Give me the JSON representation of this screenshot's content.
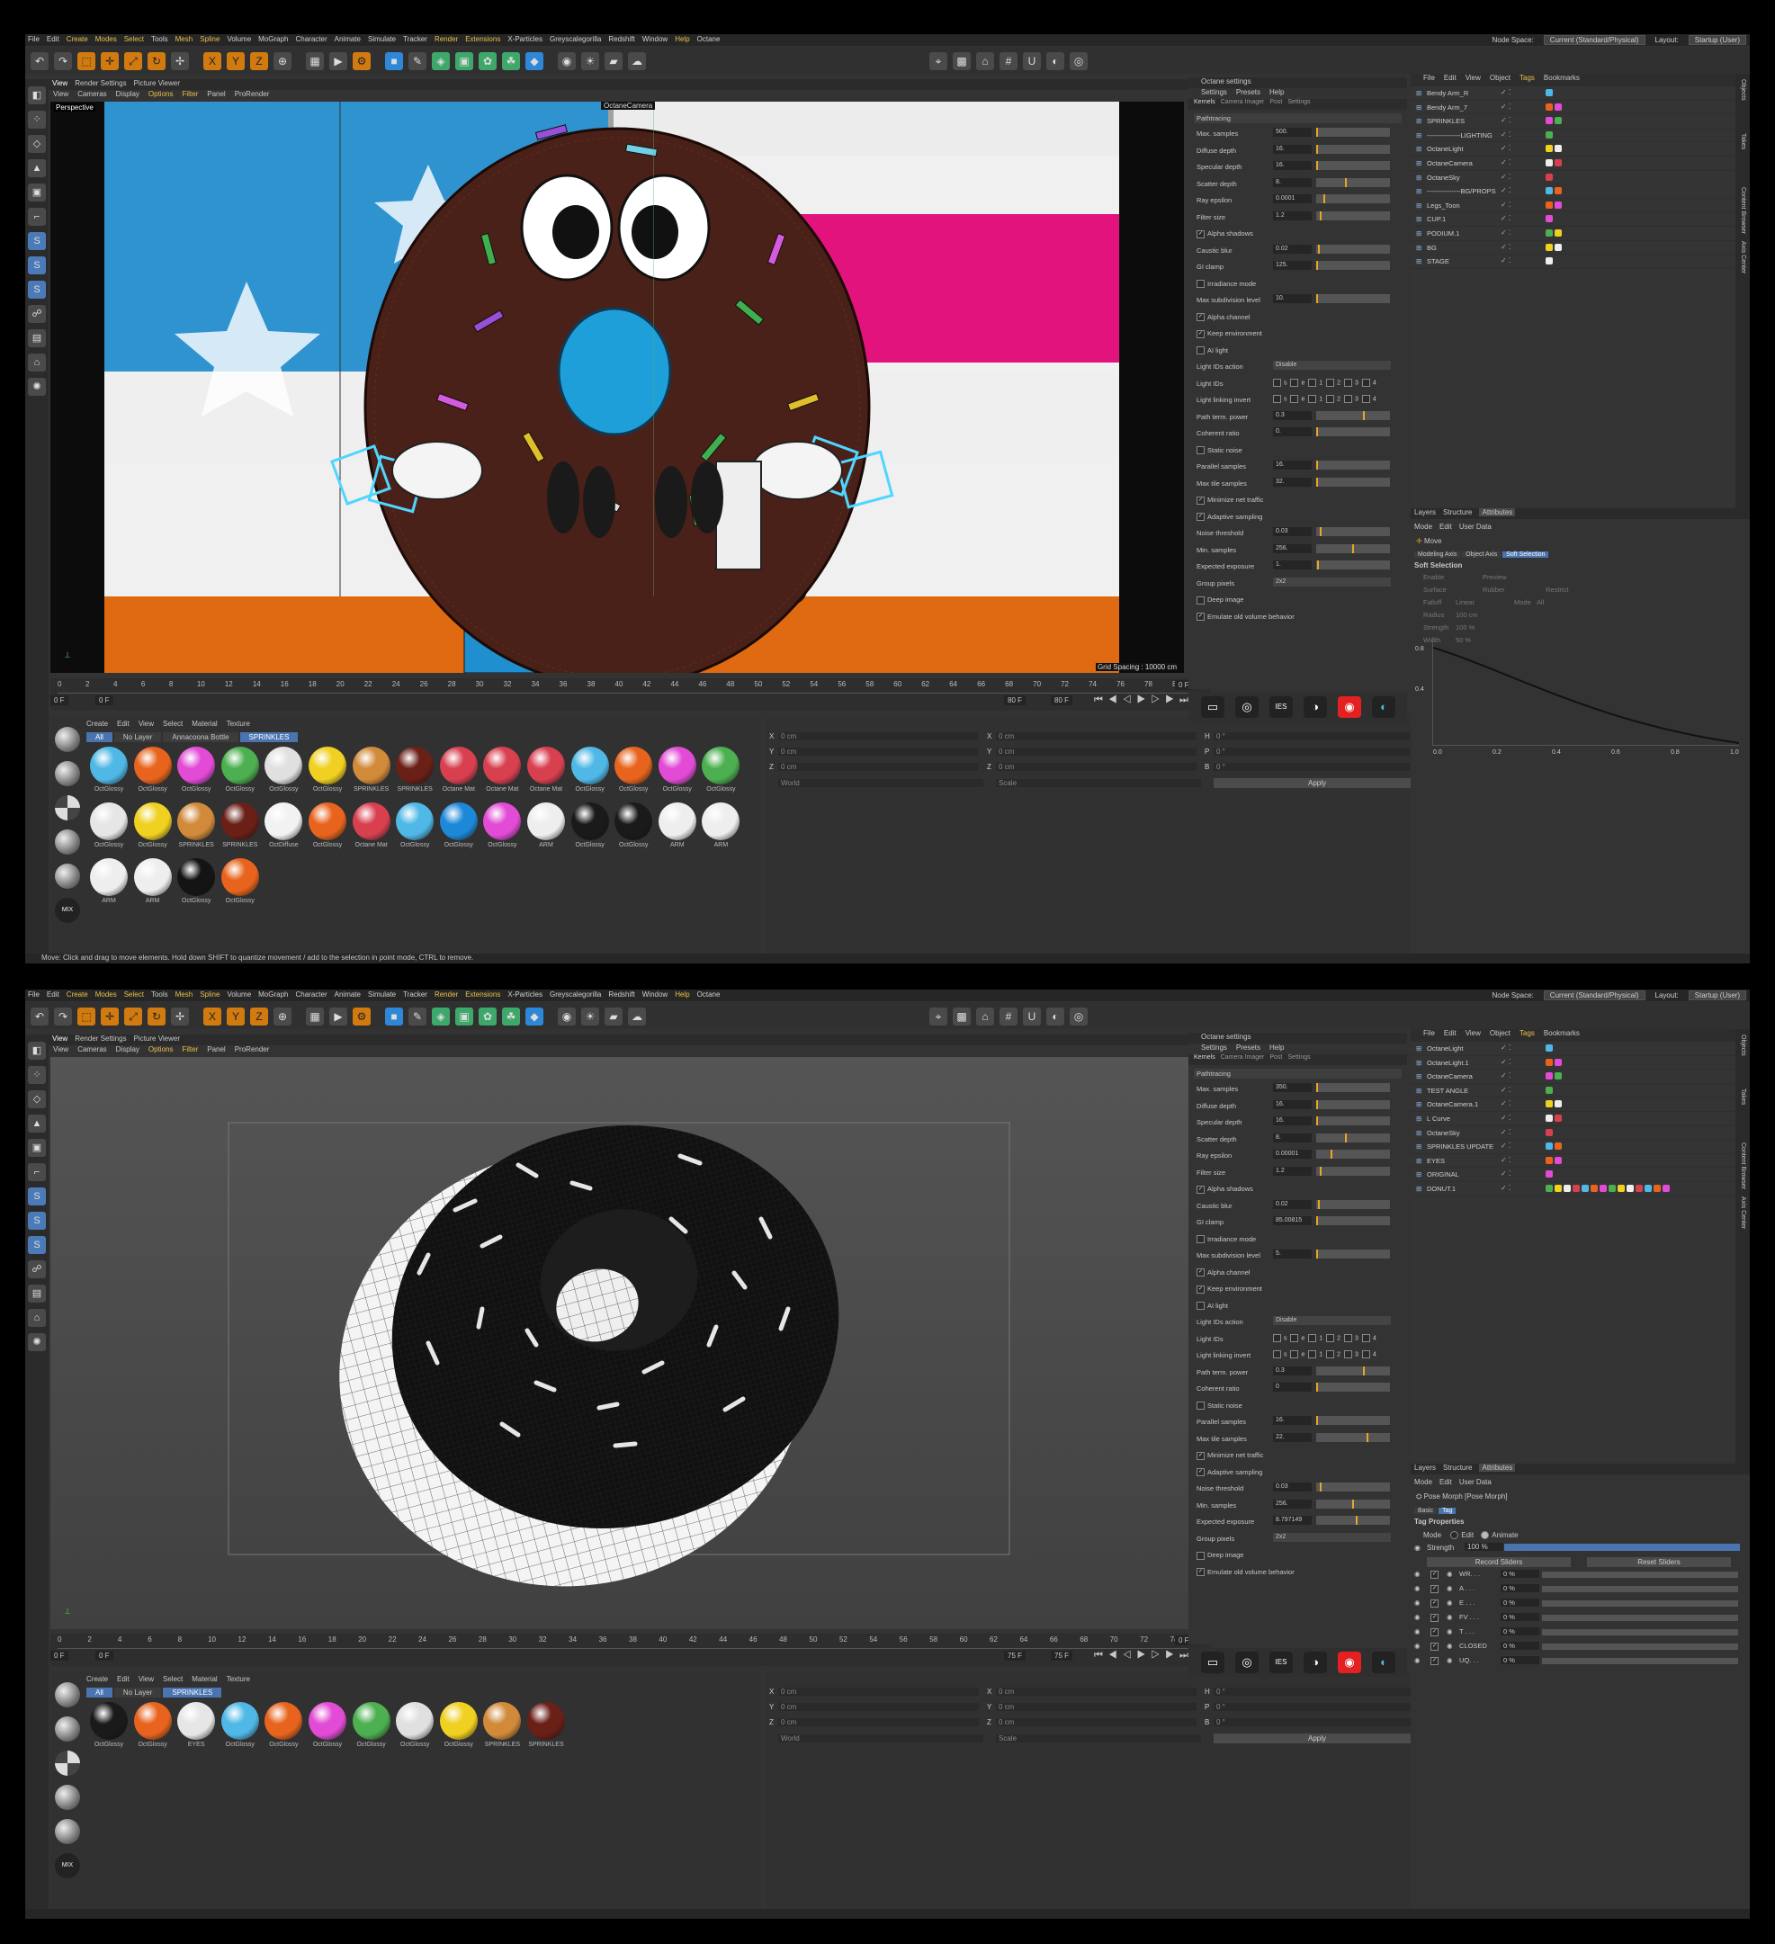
{
  "menu": [
    "File",
    "Edit",
    "Create",
    "Modes",
    "Select",
    "Tools",
    "Mesh",
    "Spline",
    "Volume",
    "MoGraph",
    "Character",
    "Animate",
    "Simulate",
    "Tracker",
    "Render",
    "Extensions",
    "X-Particles",
    "Greyscalegorilla",
    "Redshift",
    "Window",
    "Help",
    "Octane"
  ],
  "node_space_label": "Node Space:",
  "node_space_value": "Current (Standard/Physical)",
  "layout_label": "Layout:",
  "layout_value": "Startup (User)",
  "viewport_tabs": [
    "View",
    "Render Settings",
    "Picture Viewer"
  ],
  "viewport_menu": [
    "View",
    "Cameras",
    "Display",
    "Options",
    "Filter",
    "Panel",
    "ProRender"
  ],
  "octane_title": "Octane settings",
  "octane_menu": [
    "Settings",
    "Presets",
    "Help"
  ],
  "octane_tabs": [
    "Kernels",
    "Camera Imager",
    "Post",
    "Settings"
  ],
  "octane_section": "Pathtracing",
  "obj_menu": [
    "File",
    "Edit",
    "View",
    "Object",
    "Tags",
    "Bookmarks"
  ],
  "attr_tabs": [
    "Layers",
    "Structure",
    "Attributes"
  ],
  "attr_menu": [
    "Mode",
    "Edit",
    "User Data"
  ],
  "coord": {
    "x": "X",
    "y": "Y",
    "z": "Z",
    "h": "H",
    "p": "P",
    "b": "B",
    "zero_cm": "0 cm",
    "zero_deg": "0 °",
    "world": "World",
    "scale": "Scale",
    "apply": "Apply"
  },
  "mat_menu": [
    "Create",
    "Edit",
    "View",
    "Select",
    "Material",
    "Texture"
  ],
  "side_tabs": [
    "Objects",
    "Takes",
    "Content Browser",
    "Axis Center"
  ],
  "top": {
    "perspective": "Perspective",
    "camera_label": "OctaneCamera",
    "grid_spacing": "Grid Spacing : 10000 cm",
    "ruler": [
      "0",
      "2",
      "4",
      "6",
      "8",
      "10",
      "12",
      "14",
      "16",
      "18",
      "20",
      "22",
      "24",
      "26",
      "28",
      "30",
      "32",
      "34",
      "36",
      "38",
      "40",
      "42",
      "44",
      "46",
      "48",
      "50",
      "52",
      "54",
      "56",
      "58",
      "60",
      "62",
      "64",
      "66",
      "68",
      "70",
      "72",
      "74",
      "76",
      "78",
      "80"
    ],
    "frame_start": "0 F",
    "frame_start2": "0 F",
    "frame_end": "80 F",
    "frame_end2": "80 F",
    "frame_cur": "0 F",
    "mat_tabs": [
      "All",
      "No Layer",
      "Annacoona Bottle",
      "SPRINKLES"
    ],
    "materials": [
      {
        "label": "OctGlossy",
        "color": "#4fb8e6"
      },
      {
        "label": "OctGlossy",
        "color": "#e8641e"
      },
      {
        "label": "OctGlossy",
        "color": "#e24bd6"
      },
      {
        "label": "OctGlossy",
        "color": "#4caf50"
      },
      {
        "label": "OctGlossy",
        "color": "#e0e0e0"
      },
      {
        "label": "OctGlossy",
        "color": "#f0d020"
      },
      {
        "label": "SPRINKLES",
        "color": "#d08a3a"
      },
      {
        "label": "SPRINKLES",
        "color": "#6a1f17"
      },
      {
        "label": "Octane Mat",
        "color": "#d84050"
      },
      {
        "label": "Octane Mat",
        "color": "#d84050"
      },
      {
        "label": "Octane Mat",
        "color": "#d84050"
      },
      {
        "label": "OctGlossy",
        "color": "#4fb8e6"
      },
      {
        "label": "OctGlossy",
        "color": "#e8641e"
      },
      {
        "label": "OctGlossy",
        "color": "#e24bd6"
      },
      {
        "label": "OctGlossy",
        "color": "#4caf50"
      },
      {
        "label": "OctGlossy",
        "color": "#e6e6e6"
      },
      {
        "label": "OctGlossy",
        "color": "#f0d020"
      },
      {
        "label": "SPRINKLES",
        "color": "#d08a3a"
      },
      {
        "label": "SPRINKLES",
        "color": "#6a1f17"
      },
      {
        "label": "OctDiffuse",
        "color": "#f2f2f2"
      },
      {
        "label": "OctGlossy",
        "color": "#e8641e"
      },
      {
        "label": "Octane Mat",
        "color": "#d84050"
      },
      {
        "label": "OctGlossy",
        "color": "#4fb8e6"
      },
      {
        "label": "OctGlossy",
        "color": "#1e88d8"
      },
      {
        "label": "OctGlossy",
        "color": "#e24bd6"
      },
      {
        "label": "ARM",
        "color": "#eeeeee"
      },
      {
        "label": "OctGlossy",
        "color": "#1a1a1a"
      },
      {
        "label": "OctGlossy",
        "color": "#1a1a1a"
      },
      {
        "label": "ARM",
        "color": "#eeeeee"
      },
      {
        "label": "ARM",
        "color": "#eeeeee"
      },
      {
        "label": "ARM",
        "color": "#eeeeee"
      },
      {
        "label": "ARM",
        "color": "#eeeeee"
      },
      {
        "label": "OctGlossy",
        "color": "#141414"
      },
      {
        "label": "OctGlossy",
        "color": "#e8641e"
      }
    ],
    "settings": [
      {
        "label": "Max. samples",
        "value": "500.",
        "fill": 0.0
      },
      {
        "label": "Diffuse depth",
        "value": "16.",
        "fill": 0.0
      },
      {
        "label": "Specular depth",
        "value": "16.",
        "fill": 0.0
      },
      {
        "label": "Scatter depth",
        "value": "8.",
        "fill": 0.4
      },
      {
        "label": "Ray epsilon",
        "value": "0.0001",
        "fill": 0.1
      },
      {
        "label": "Filter size",
        "value": "1.2",
        "fill": 0.05
      },
      {
        "label": "Alpha shadows",
        "check": true
      },
      {
        "label": "Caustic blur",
        "value": "0.02",
        "fill": 0.02
      },
      {
        "label": "GI clamp",
        "value": "125.",
        "fill": 0.0
      },
      {
        "label": "Irradiance mode",
        "check": false
      },
      {
        "label": "Max subdivision level",
        "value": "10.",
        "fill": 0.0
      },
      {
        "label": "Alpha channel",
        "check": true
      },
      {
        "label": "Keep environment",
        "check": true
      },
      {
        "label": "AI light",
        "check": false
      },
      {
        "label": "Light IDs action",
        "value": "Disable",
        "select": true
      },
      {
        "label": "Light IDs",
        "ids": true
      },
      {
        "label": "Light linking invert",
        "ids": true
      },
      {
        "label": "Path term. power",
        "value": "0.3",
        "fill": 0.65
      },
      {
        "label": "Coherent ratio",
        "value": "0.",
        "fill": 0.0
      },
      {
        "label": "Static noise",
        "check": false
      },
      {
        "label": "Parallel samples",
        "value": "16.",
        "fill": 0.0
      },
      {
        "label": "Max tile samples",
        "value": "32.",
        "fill": 0.0
      },
      {
        "label": "Minimize net traffic",
        "check": true
      },
      {
        "label": "Adaptive sampling",
        "check": true
      },
      {
        "label": "Noise threshold",
        "value": "0.03",
        "fill": 0.05
      },
      {
        "label": "Min. samples",
        "value": "256.",
        "fill": 0.5
      },
      {
        "label": "Expected exposure",
        "value": "1.",
        "fill": 0.01
      },
      {
        "label": "Group pixels",
        "value": "2x2",
        "select": true
      },
      {
        "label": "Deep image",
        "check": false
      },
      {
        "label": "Emulate old volume behavior",
        "check": true
      }
    ],
    "objects": [
      {
        "name": "Bendy Arm_R",
        "blue": false
      },
      {
        "name": "Bendy Arm_7",
        "blue": false
      },
      {
        "name": "SPRINKLES",
        "blue": false
      },
      {
        "name": "---------------LIGHTING",
        "blue": false
      },
      {
        "name": "OctaneLight",
        "blue": false
      },
      {
        "name": "OctaneCamera",
        "blue": false
      },
      {
        "name": "OctaneSky",
        "blue": false
      },
      {
        "name": "---------------BG/PROPS",
        "blue": false
      },
      {
        "name": "Legs_Toon",
        "blue": false
      },
      {
        "name": "CUP.1",
        "blue": false
      },
      {
        "name": "PODIUM.1",
        "blue": false
      },
      {
        "name": "BG",
        "blue": false
      },
      {
        "name": "STAGE",
        "blue": false
      }
    ],
    "attr_mode": "Move",
    "attr_sub_tabs": [
      "Modeling Axis",
      "Object Axis",
      "Soft Selection"
    ],
    "soft_title": "Soft Selection",
    "soft_rows": [
      "Enable",
      "Preview",
      "Surface",
      "Rubber",
      "Restrict",
      "Falloff",
      "Linear",
      "Mode",
      "All",
      "Radius",
      "100 cm",
      "Strength",
      "100 %",
      "Width",
      "50 %"
    ],
    "graph_x": [
      "0.0",
      "0.2",
      "0.4",
      "0.6",
      "0.8",
      "1.0"
    ],
    "graph_y": [
      "0.8",
      "0.4"
    ],
    "status": "Move: Click and drag to move elements. Hold down SHIFT to quantize movement / add to the selection in point mode, CTRL to remove."
  },
  "bottom": {
    "ruler": [
      "0",
      "2",
      "4",
      "6",
      "8",
      "10",
      "12",
      "14",
      "16",
      "18",
      "20",
      "22",
      "24",
      "26",
      "28",
      "30",
      "32",
      "34",
      "36",
      "38",
      "40",
      "42",
      "44",
      "46",
      "48",
      "50",
      "52",
      "54",
      "56",
      "58",
      "60",
      "62",
      "64",
      "66",
      "68",
      "70",
      "72",
      "74"
    ],
    "frame_start": "0 F",
    "frame_start2": "0 F",
    "frame_end": "75 F",
    "frame_end2": "75 F",
    "frame_cur": "0 F",
    "mat_tabs": [
      "All",
      "No Layer",
      "SPRINKLES"
    ],
    "materials": [
      {
        "label": "OctGlossy",
        "color": "#1a1a1a"
      },
      {
        "label": "OctGlossy",
        "color": "#e8641e"
      },
      {
        "label": "EYES",
        "color": "#e6e6e6"
      },
      {
        "label": "OctGlossy",
        "color": "#4fb8e6"
      },
      {
        "label": "OctGlossy",
        "color": "#e8641e"
      },
      {
        "label": "OctGlossy",
        "color": "#e24bd6"
      },
      {
        "label": "OctGlossy",
        "color": "#4caf50"
      },
      {
        "label": "OctGlossy",
        "color": "#e0e0e0"
      },
      {
        "label": "OctGlossy",
        "color": "#f0d020"
      },
      {
        "label": "SPRINKLES",
        "color": "#d08a3a"
      },
      {
        "label": "SPRINKLES",
        "color": "#6a1f17"
      }
    ],
    "settings": [
      {
        "label": "Max. samples",
        "value": "350.",
        "fill": 0.0
      },
      {
        "label": "Diffuse depth",
        "value": "16.",
        "fill": 0.0
      },
      {
        "label": "Specular depth",
        "value": "16.",
        "fill": 0.0
      },
      {
        "label": "Scatter depth",
        "value": "8.",
        "fill": 0.4
      },
      {
        "label": "Ray epsilon",
        "value": "0.00001",
        "fill": 0.2
      },
      {
        "label": "Filter size",
        "value": "1.2",
        "fill": 0.05
      },
      {
        "label": "Alpha shadows",
        "check": true
      },
      {
        "label": "Caustic blur",
        "value": "0.02",
        "fill": 0.02
      },
      {
        "label": "GI clamp",
        "value": "85.00815",
        "fill": 0.0
      },
      {
        "label": "Irradiance mode",
        "check": false
      },
      {
        "label": "Max subdivision level",
        "value": "5.",
        "fill": 0.0
      },
      {
        "label": "Alpha channel",
        "check": true
      },
      {
        "label": "Keep environment",
        "check": true
      },
      {
        "label": "AI light",
        "check": false
      },
      {
        "label": "Light IDs action",
        "value": "Disable",
        "select": true
      },
      {
        "label": "Light IDs",
        "ids": true
      },
      {
        "label": "Light linking invert",
        "ids": true
      },
      {
        "label": "Path term. power",
        "value": "0.3",
        "fill": 0.65
      },
      {
        "label": "Coherent ratio",
        "value": "0",
        "fill": 0.0
      },
      {
        "label": "Static noise",
        "check": false
      },
      {
        "label": "Parallel samples",
        "value": "16.",
        "fill": 0.0
      },
      {
        "label": "Max tile samples",
        "value": "22.",
        "fill": 0.7
      },
      {
        "label": "Minimize net traffic",
        "check": true
      },
      {
        "label": "Adaptive sampling",
        "check": true
      },
      {
        "label": "Noise threshold",
        "value": "0.03",
        "fill": 0.05
      },
      {
        "label": "Min. samples",
        "value": "256.",
        "fill": 0.5
      },
      {
        "label": "Expected exposure",
        "value": "8.797149",
        "fill": 0.55
      },
      {
        "label": "Group pixels",
        "value": "2x2",
        "select": true
      },
      {
        "label": "Deep image",
        "check": false
      },
      {
        "label": "Emulate old volume behavior",
        "check": true
      }
    ],
    "objects": [
      {
        "name": "OctaneLight",
        "blue": false
      },
      {
        "name": "OctaneLight.1",
        "blue": false
      },
      {
        "name": "OctaneCamera",
        "blue": false
      },
      {
        "name": "TEST ANGLE",
        "blue": false
      },
      {
        "name": "OctaneCamera.1",
        "blue": false
      },
      {
        "name": "L Curve",
        "blue": false
      },
      {
        "name": "OctaneSky",
        "blue": false
      },
      {
        "name": "SPRINKLES UPDATE",
        "blue": false
      },
      {
        "name": "EYES",
        "blue": false
      },
      {
        "name": "ORIGINAL",
        "blue": false
      },
      {
        "name": "DONUT.1",
        "blue": false
      }
    ],
    "tag_title": "Pose Morph [Pose Morph]",
    "tag_tabs": [
      "Basic",
      "Tag"
    ],
    "tag_props": "Tag Properties",
    "mode_label": "Mode",
    "mode_edit": "Edit",
    "mode_animate": "Animate",
    "strength_label": "Strength",
    "strength_value": "100 %",
    "record": "Record Sliders",
    "reset": "Reset Sliders",
    "morphs": [
      {
        "name": "WR. . .",
        "value": "0 %"
      },
      {
        "name": "A . . .",
        "value": "0 %"
      },
      {
        "name": "E . . .",
        "value": "0 %"
      },
      {
        "name": "FV . . .",
        "value": "0 %"
      },
      {
        "name": "T . . .",
        "value": "0 %"
      },
      {
        "name": "CLOSED",
        "value": "0 %"
      },
      {
        "name": "UQ. . .",
        "value": "0 %"
      }
    ]
  }
}
